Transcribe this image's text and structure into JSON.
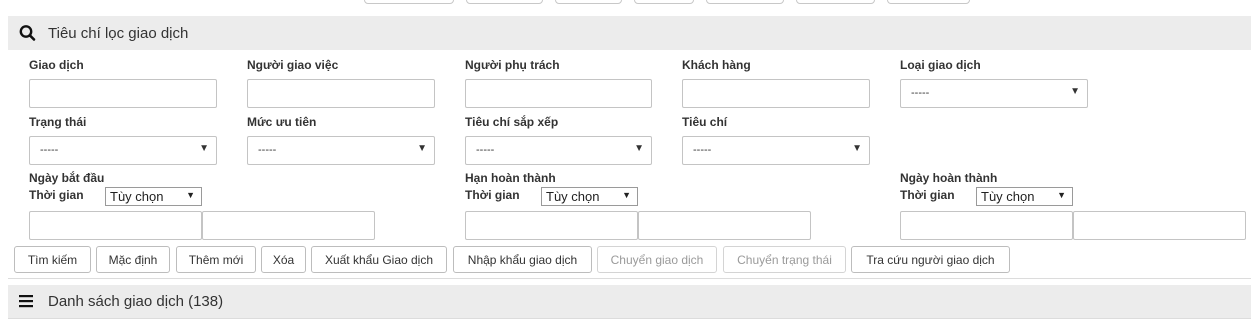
{
  "filter_panel": {
    "title": "Tiêu chí lọc giao dịch"
  },
  "fields": {
    "giao_dich": "Giao dịch",
    "nguoi_giao_viec": "Người giao việc",
    "nguoi_phu_trach": "Người phụ trách",
    "khach_hang": "Khách hàng",
    "loai_giao_dich": "Loại giao dịch",
    "trang_thai": "Trạng thái",
    "muc_uu_tien": "Mức ưu tiên",
    "tieu_chi_sap_xep": "Tiêu chí sắp xếp",
    "tieu_chi": "Tiêu chí"
  },
  "select_default": "-----",
  "date_groups": {
    "ngay_bat_dau": "Ngày bắt đầu",
    "han_hoan_thanh": "Hạn hoàn thành",
    "ngay_hoan_thanh": "Ngày hoàn thành",
    "thoi_gian": "Thời gian",
    "tuy_chon": "Tùy chọn"
  },
  "buttons": {
    "tim_kiem": "Tìm kiếm",
    "mac_dinh": "Mặc định",
    "them_moi": "Thêm mới",
    "xoa": "Xóa",
    "xuat_khau": "Xuất khẩu Giao dịch",
    "nhap_khau": "Nhập khẩu giao dịch",
    "chuyen_giao_dich": "Chuyển giao dịch",
    "chuyen_trang_thai": "Chuyển trạng thái",
    "tra_cuu": "Tra cứu người giao dịch"
  },
  "list_panel": {
    "title": "Danh sách giao dịch (138)"
  }
}
